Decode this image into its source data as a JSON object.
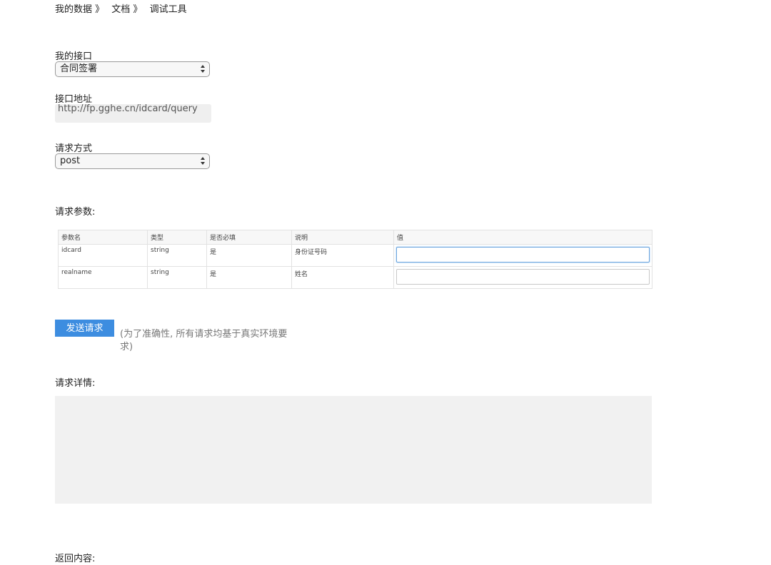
{
  "breadcrumb": [
    "我的数据 》",
    "文档 》",
    "调试工具"
  ],
  "api": {
    "label": "我的接口",
    "selected": "合同签署"
  },
  "address": {
    "label": "接口地址",
    "value": "http://fp.gghe.cn/idcard/query"
  },
  "method": {
    "label": "请求方式",
    "selected": "post"
  },
  "params": {
    "label": "请求参数:",
    "headers": [
      "参数名",
      "类型",
      "是否必填",
      "说明",
      "值"
    ],
    "rows": [
      {
        "name": "idcard",
        "type": "string",
        "required": "是",
        "desc": "身份证号码",
        "value": ""
      },
      {
        "name": "realname",
        "type": "string",
        "required": "是",
        "desc": "姓名",
        "value": ""
      }
    ]
  },
  "send": {
    "button": "发送请求",
    "note": "(为了准确性, 所有请求均基于真实环境要求)"
  },
  "details": {
    "label": "请求详情:",
    "content": ""
  },
  "response": {
    "label": "返回内容:"
  },
  "colors": {
    "accent": "#3d8de0",
    "panel": "#f1f1f1"
  }
}
